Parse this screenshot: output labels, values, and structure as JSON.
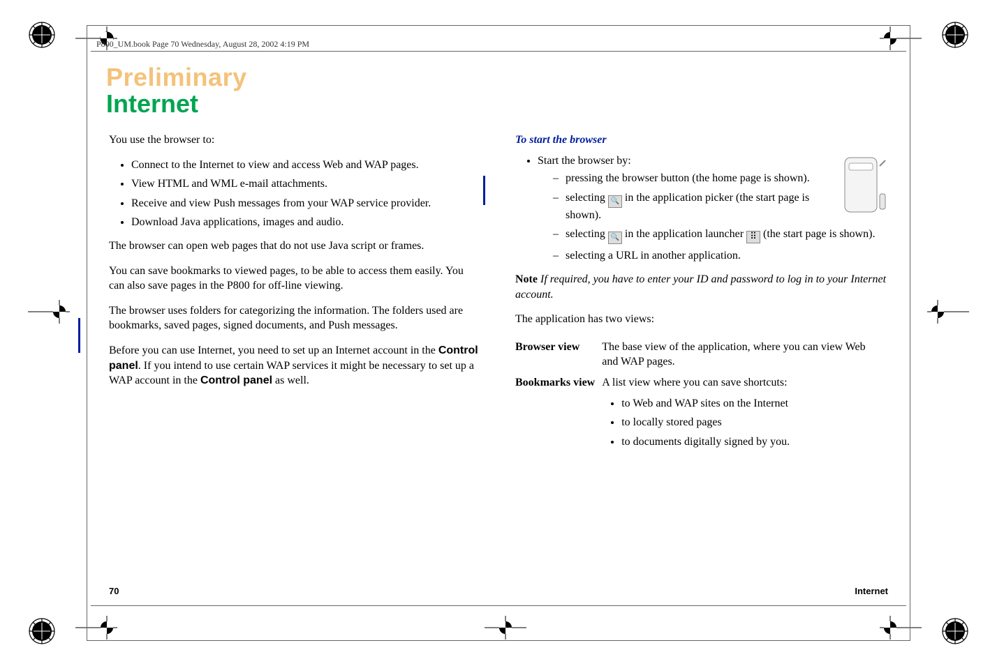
{
  "book_header": "P800_UM.book  Page 70  Wednesday, August 28, 2002  4:19 PM",
  "watermark": "Preliminary",
  "title": "Internet",
  "left": {
    "intro": "You use the browser to:",
    "bullets": [
      "Connect to the Internet to view and access Web and WAP pages.",
      "View HTML and WML e-mail attachments.",
      "Receive and view Push messages from your WAP service provider.",
      "Download Java applications, images and audio."
    ],
    "p1": "The browser can open web pages that do not use Java script or frames.",
    "p2": "You can save bookmarks to viewed pages, to be able to access them easily. You can also save pages in the P800 for off-line viewing.",
    "p3": "The browser uses folders for categorizing the information. The folders used are bookmarks, saved pages, signed documents, and Push messages.",
    "p4a": "Before you can use Internet, you need to set up an Internet account in the ",
    "p4b": "Control panel",
    "p4c": ". If you intend to use certain WAP services it might be necessary to set up a WAP account in the ",
    "p4d": "Control panel",
    "p4e": " as well."
  },
  "right": {
    "subhead": "To start the browser",
    "lead": "Start the browser by:",
    "dash1": "pressing the browser button (the home page is shown).",
    "dash2a": "selecting ",
    "dash2b": " in the application picker (the start page is shown).",
    "dash3a": "selecting ",
    "dash3b": " in the application launcher ",
    "dash3c": " (the start page is shown).",
    "dash4": "selecting a URL in another application.",
    "note_label": "Note ",
    "note_body": "If required, you have to enter your ID and password to log in to your Internet account.",
    "views_intro": "The application has two views:",
    "views": {
      "browser_label": "Browser view",
      "browser_desc": "The base view of the application, where you can view Web and WAP pages.",
      "bookmarks_label": "Bookmarks view",
      "bookmarks_desc": "A list view where you can save shortcuts:",
      "bookmarks_items": [
        "to Web and WAP sites on the Internet",
        "to locally stored pages",
        "to documents digitally signed by you."
      ]
    }
  },
  "footer": {
    "page": "70",
    "section": "Internet"
  },
  "chart_data": null
}
